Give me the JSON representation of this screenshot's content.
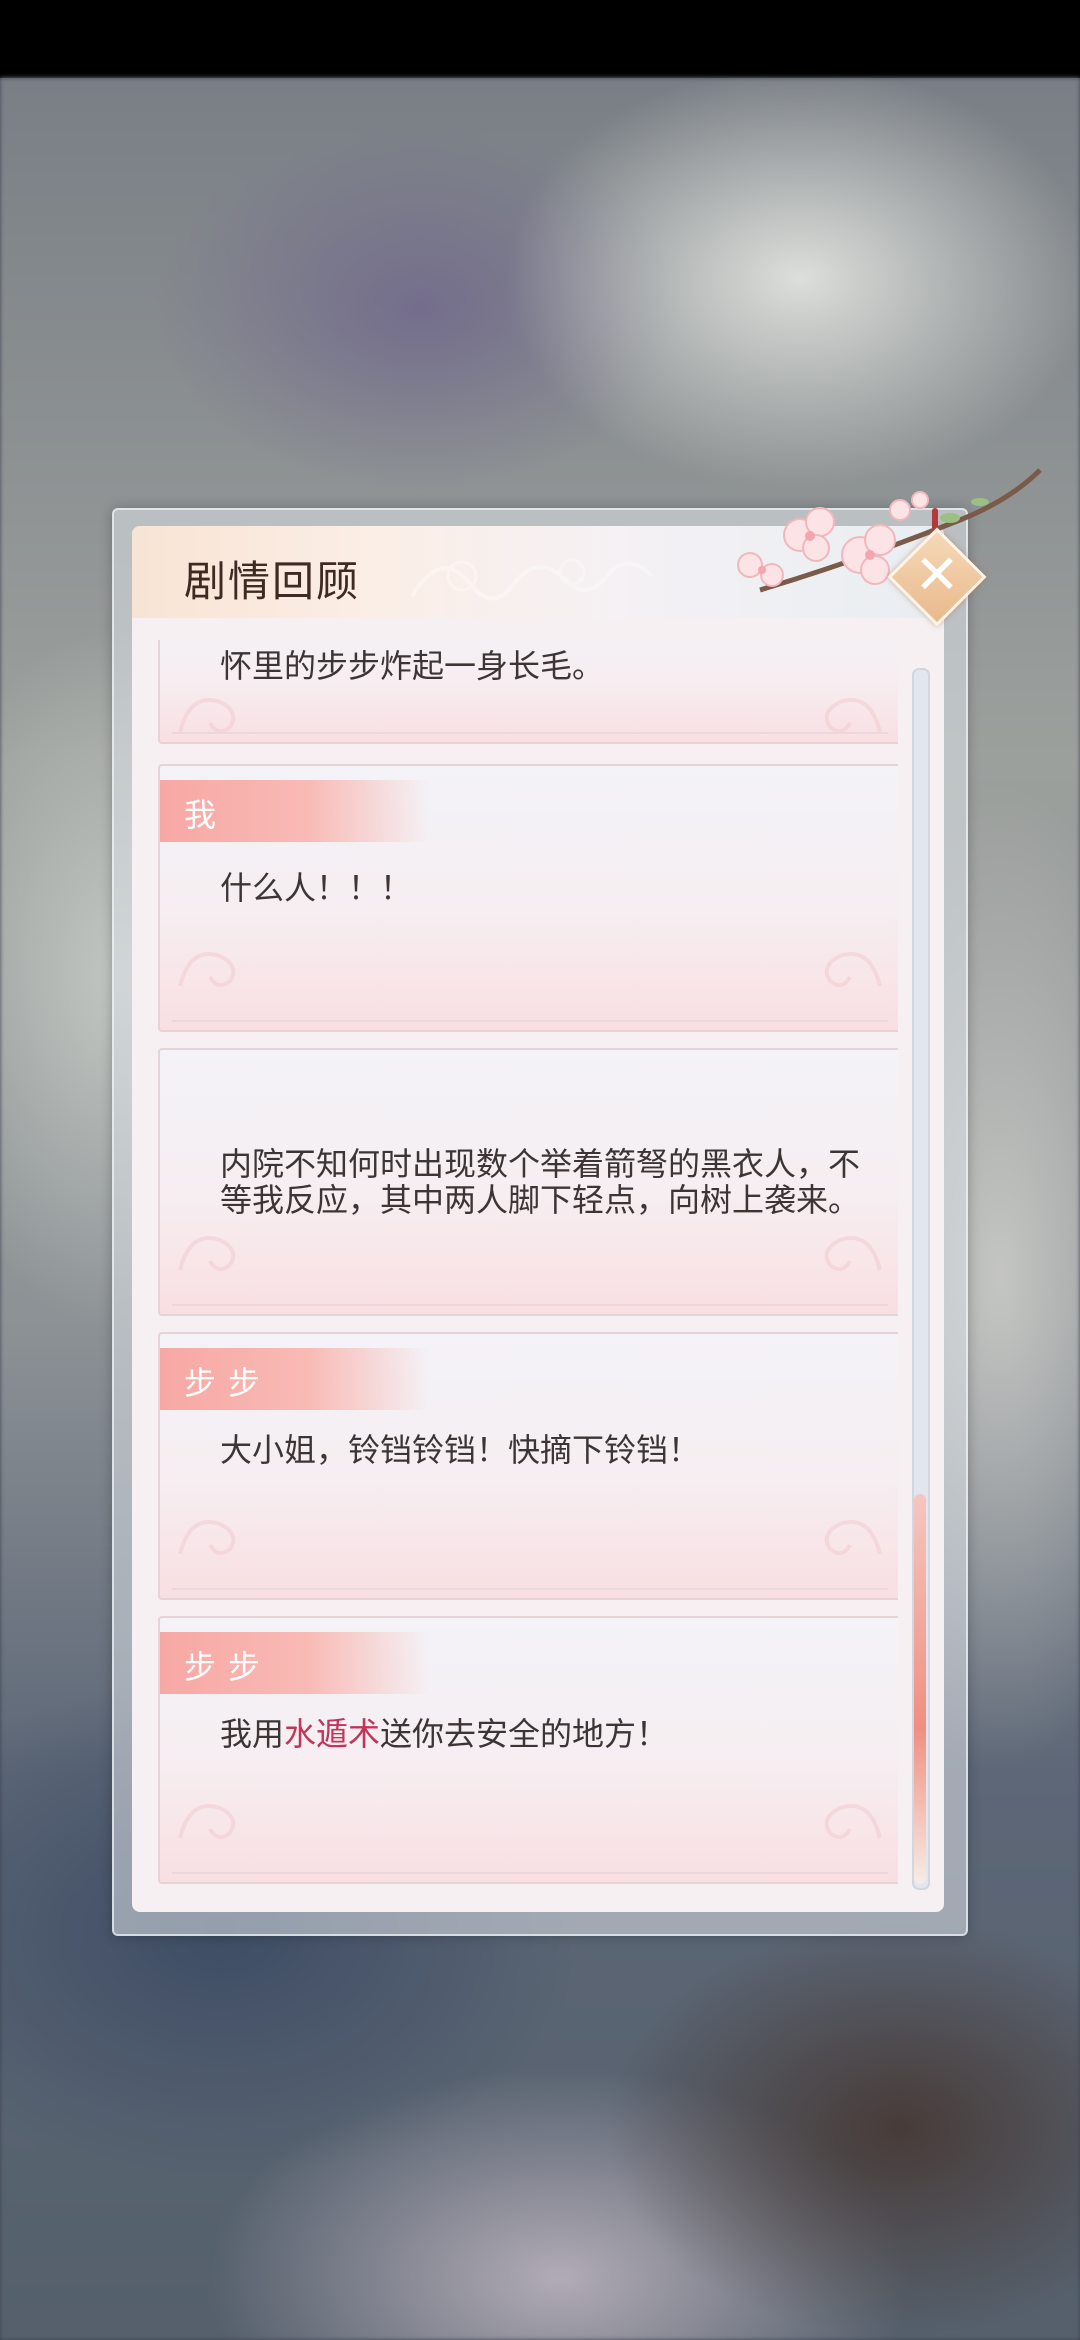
{
  "dialog": {
    "title": "剧情回顾"
  },
  "entries": [
    {
      "speaker": "",
      "text": "怀里的步步炸起一身长毛。"
    },
    {
      "speaker": "我",
      "text": "什么人！！！"
    },
    {
      "speaker": "",
      "text": "内院不知何时出现数个举着箭弩的黑衣人，不等我反应，其中两人脚下轻点，向树上袭来。"
    },
    {
      "speaker": "步步",
      "text": "大小姐，铃铛铃铛！快摘下铃铛！"
    },
    {
      "speaker": "步步",
      "text_before": "我用",
      "text_highlight": "水遁术",
      "text_after": "送你去安全的地方！"
    }
  ],
  "colors": {
    "speaker_tag": "#f7a8a4",
    "highlight": "#c2345a",
    "scroll_thumb": "#f08f80"
  },
  "icons": {
    "close": "close-icon",
    "blossom": "blossom-decoration"
  },
  "scroll": {
    "position_fraction": 1.0
  }
}
